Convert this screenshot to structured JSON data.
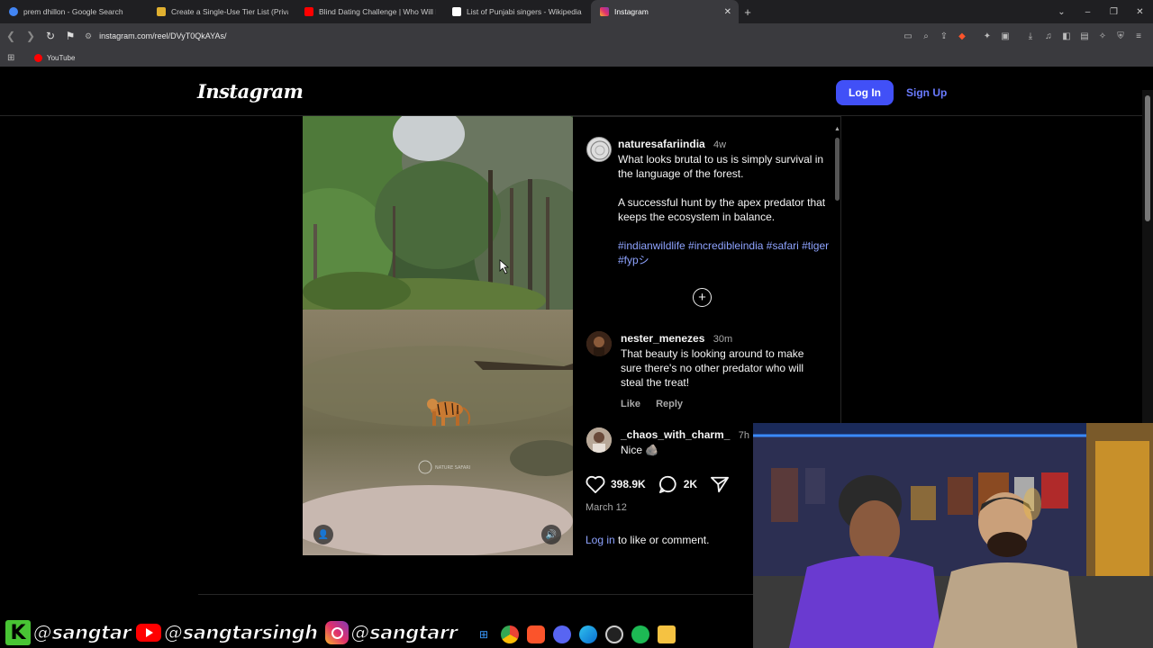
{
  "browser": {
    "tabs": [
      {
        "label": "prem dhillon - Google Search",
        "favicon": "google-icon",
        "color": "#4285f4"
      },
      {
        "label": "Create a Single-Use Tier List (Private",
        "favicon": "tierlist-icon",
        "color": "#e0b030"
      },
      {
        "label": "Blind Dating Challenge | Who Will Ki",
        "favicon": "youtube-icon",
        "color": "#ff0000"
      },
      {
        "label": "List of Punjabi singers - Wikipedia",
        "favicon": "wikipedia-icon",
        "color": "#ffffff"
      },
      {
        "label": "Instagram",
        "favicon": "instagram-icon",
        "color": "#e1306c",
        "active": true
      }
    ],
    "url": "instagram.com/reel/DVyT0QkAYAs/",
    "bookmarks": [
      {
        "label": "YouTube"
      }
    ]
  },
  "instagram": {
    "logo": "Instagram",
    "login_button": "Log In",
    "signup_link": "Sign Up",
    "post": {
      "username": "naturesafariindia",
      "time": "4w",
      "caption_1": "What looks brutal to us is simply survival in the language of the forest.",
      "caption_2": "A successful hunt by the apex predator that keeps the ecosystem in balance.",
      "hashtags": "#indianwildlife #incredibleindia #safari #tiger #fypシ",
      "likes": "398.9K",
      "comments_count": "2K",
      "date": "March 12",
      "login_link": "Log in",
      "login_suffix": " to like or comment.",
      "watermark": "NATURE SAFARI"
    },
    "comments": [
      {
        "username": "nester_menezes",
        "time": "30m",
        "text": "That beauty is looking around to make sure there's no other predator who will steal the treat!",
        "like": "Like",
        "reply": "Reply"
      },
      {
        "username": "_chaos_with_charm_",
        "time": "7h",
        "text": "Nice 🪨"
      }
    ]
  },
  "overlay": {
    "handle_1": "@sangtar",
    "handle_2": "@sangtarsingh",
    "handle_3": "@sangtarr",
    "k_badge": "K"
  },
  "colors": {
    "accent": "#4150f7",
    "link": "#8ea3ff",
    "background": "#000000"
  }
}
